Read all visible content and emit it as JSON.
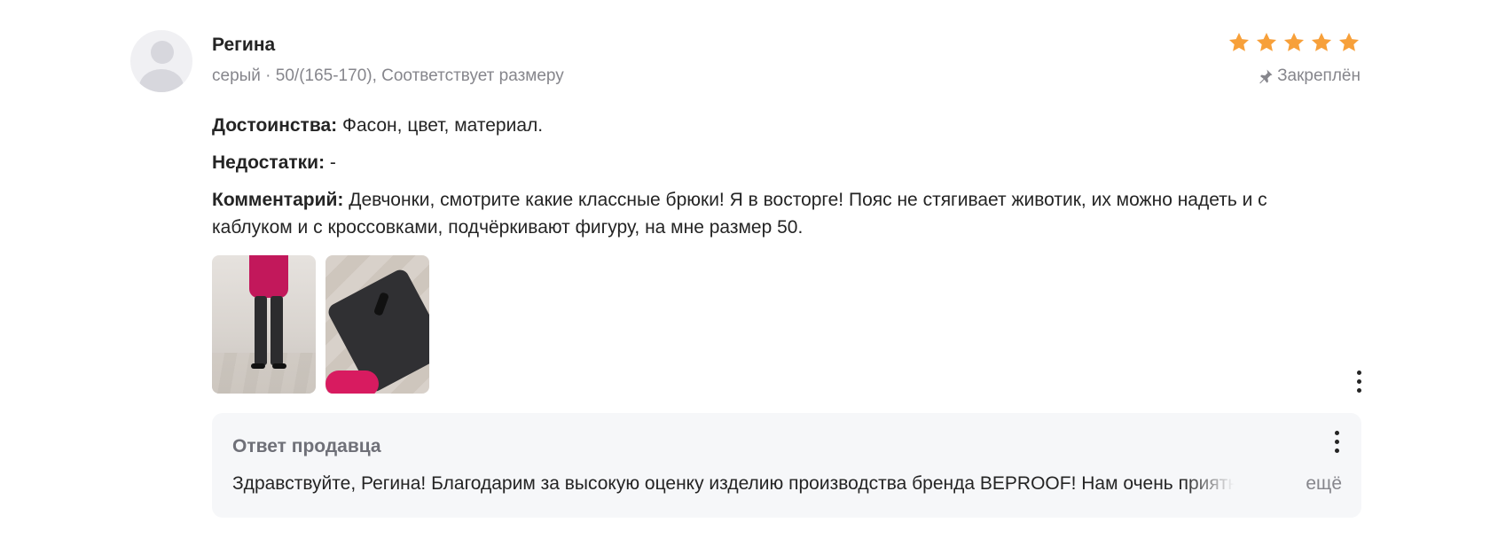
{
  "review": {
    "author": "Регина",
    "meta": "серый · 50/(165-170), Соответствует размеру",
    "rating": 5,
    "pinned_label": "Закреплён",
    "pros_label": "Достоинства:",
    "pros_text": " Фасон, цвет, материал.",
    "cons_label": "Недостатки:",
    "cons_text": " -",
    "comment_label": "Комментарий:",
    "comment_text": " Девчонки, смотрите какие классные брюки! Я в восторге! Пояс не стягивает животик, их можно надеть и с каблуком и с кроссовками, подчёркивают фигуру, на мне размер 50."
  },
  "seller_answer": {
    "title": "Ответ продавца",
    "text": "Здравствуйте, Регина! Благодарим за высокую оценку изделию производства бренда BEPROOF! Нам очень приятно",
    "more_label": "ещё"
  },
  "colors": {
    "star": "#f7a03a",
    "answer_bg": "#f6f7f9"
  }
}
